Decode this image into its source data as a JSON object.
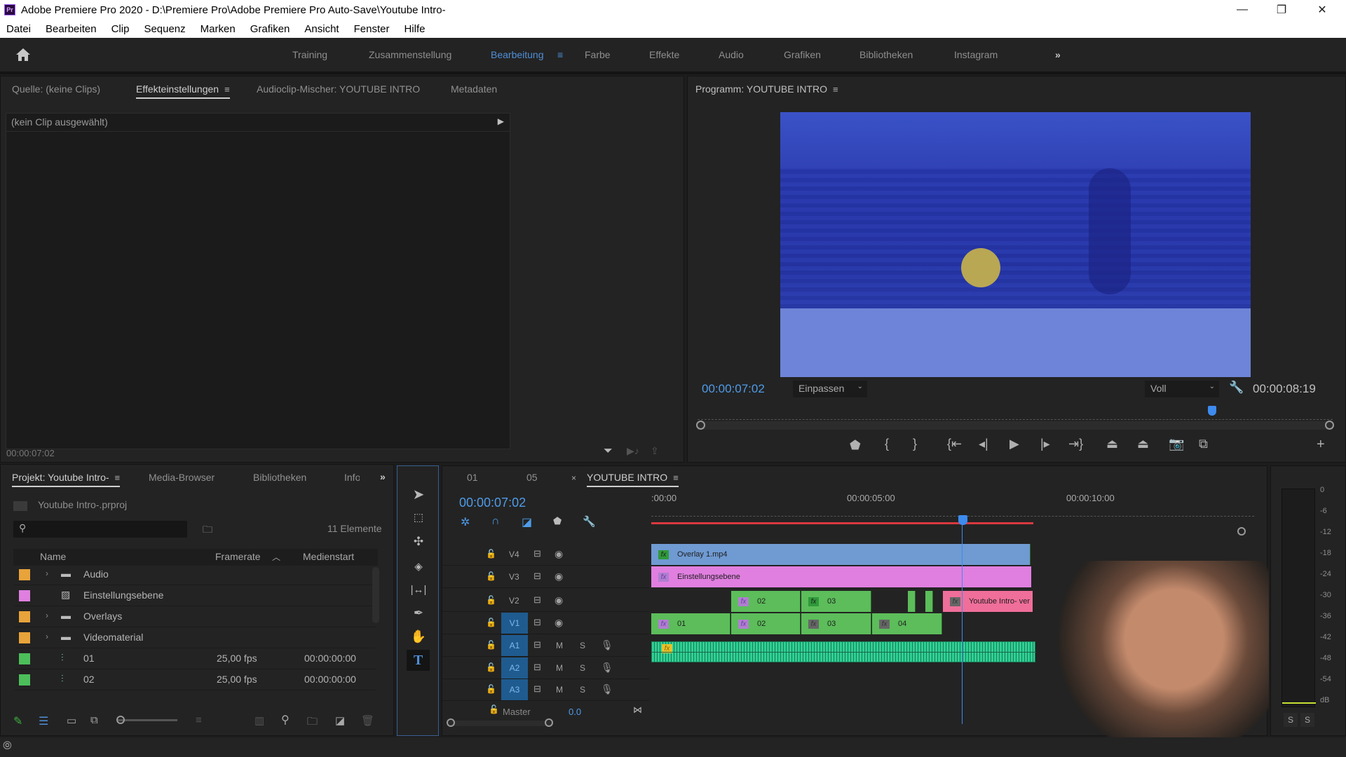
{
  "window": {
    "title": "Adobe Premiere Pro 2020 - D:\\Premiere Pro\\Adobe Premiere Pro Auto-Save\\Youtube Intro-",
    "app_icon": "Pr",
    "controls": {
      "minimize": "—",
      "maximize": "❐",
      "close": "✕"
    }
  },
  "menu": [
    "Datei",
    "Bearbeiten",
    "Clip",
    "Sequenz",
    "Marken",
    "Grafiken",
    "Ansicht",
    "Fenster",
    "Hilfe"
  ],
  "workspaces": {
    "items": [
      "Training",
      "Zusammenstellung",
      "Bearbeitung",
      "Farbe",
      "Effekte",
      "Audio",
      "Grafiken",
      "Bibliotheken",
      "Instagram"
    ],
    "active": "Bearbeitung",
    "overflow": "»"
  },
  "source_panel": {
    "tabs": [
      "Quelle: (keine Clips)",
      "Effekteinstellungen",
      "Audioclip-Mischer: YOUTUBE INTRO",
      "Metadaten"
    ],
    "active_tab": "Effekteinstellungen",
    "no_clip": "(kein Clip ausgewählt)",
    "timecode": "00:00:07:02"
  },
  "program_monitor": {
    "title": "Programm: YOUTUBE INTRO",
    "current_timecode": "00:00:07:02",
    "zoom_select": "Einpassen",
    "quality_select": "Voll",
    "duration": "00:00:08:19",
    "playhead_fraction": 0.81,
    "controls": [
      "marker",
      "mark-in",
      "mark-out",
      "go-to-in",
      "step-back",
      "play",
      "step-forward",
      "go-to-out",
      "lift",
      "extract",
      "export-frame",
      "comparison-view"
    ],
    "add_button": "+"
  },
  "project_panel": {
    "tabs": [
      "Projekt: Youtube Intro-",
      "Media-Browser",
      "Bibliotheken",
      "Info"
    ],
    "active_tab": "Projekt: Youtube Intro-",
    "overflow": "»",
    "project_file": "Youtube Intro-.prproj",
    "search_placeholder": "",
    "item_count": "11 Elemente",
    "columns": [
      "Name",
      "Framerate",
      "Medienstart"
    ],
    "items": [
      {
        "color": "#e8a33a",
        "type": "folder",
        "name": "Audio",
        "framerate": "",
        "mediastart": ""
      },
      {
        "color": "#e07fe0",
        "type": "adjustment",
        "name": "Einstellungsebene",
        "framerate": "",
        "mediastart": ""
      },
      {
        "color": "#e8a33a",
        "type": "folder",
        "name": "Overlays",
        "framerate": "",
        "mediastart": ""
      },
      {
        "color": "#e8a33a",
        "type": "folder",
        "name": "Videomaterial",
        "framerate": "",
        "mediastart": ""
      },
      {
        "color": "#4cbf5a",
        "type": "sequence",
        "name": "01",
        "framerate": "25,00 fps",
        "mediastart": "00:00:00:00"
      },
      {
        "color": "#4cbf5a",
        "type": "sequence",
        "name": "02",
        "framerate": "25,00 fps",
        "mediastart": "00:00:00:00"
      }
    ]
  },
  "tools": [
    "selection",
    "track-select-forward",
    "ripple-edit",
    "razor",
    "slip",
    "pen",
    "hand",
    "type"
  ],
  "active_tool": "type",
  "timeline": {
    "tabs": [
      "01",
      "05",
      "YOUTUBE INTRO"
    ],
    "active_tab": "YOUTUBE INTRO",
    "timecode": "00:00:07:02",
    "ruler": [
      ":00:00",
      "00:00:05:00",
      "00:00:10:00"
    ],
    "tracks": [
      {
        "id": "V4",
        "kind": "video",
        "targeted": false
      },
      {
        "id": "V3",
        "kind": "video",
        "targeted": false
      },
      {
        "id": "V2",
        "kind": "video",
        "targeted": false
      },
      {
        "id": "V1",
        "kind": "video",
        "targeted": true
      },
      {
        "id": "A1",
        "kind": "audio",
        "targeted": true
      },
      {
        "id": "A2",
        "kind": "audio",
        "targeted": true
      },
      {
        "id": "A3",
        "kind": "audio",
        "targeted": true
      }
    ],
    "audio_buttons": {
      "mute": "M",
      "solo": "S"
    },
    "master": {
      "label": "Master",
      "value": "0.0"
    },
    "clips": {
      "v4": [
        {
          "name": "Overlay 1.mp4",
          "color": "#6f9ad2"
        }
      ],
      "v3": [
        {
          "name": "Einstellungsebene",
          "color": "#e07fe0"
        }
      ],
      "v2": [
        {
          "name": "02"
        },
        {
          "name": "03"
        },
        {
          "name": "Youtube Intro- ver",
          "color": "#f06e9a"
        }
      ],
      "v1": [
        {
          "name": "01"
        },
        {
          "name": "02"
        },
        {
          "name": "03"
        },
        {
          "name": "04"
        }
      ],
      "a1": [
        {
          "name": ""
        }
      ]
    }
  },
  "audio_meter": {
    "scale": [
      "0",
      "-6",
      "-12",
      "-18",
      "-24",
      "-30",
      "-36",
      "-42",
      "-48",
      "-54",
      "dB"
    ],
    "solo_buttons": [
      "S",
      "S"
    ]
  }
}
